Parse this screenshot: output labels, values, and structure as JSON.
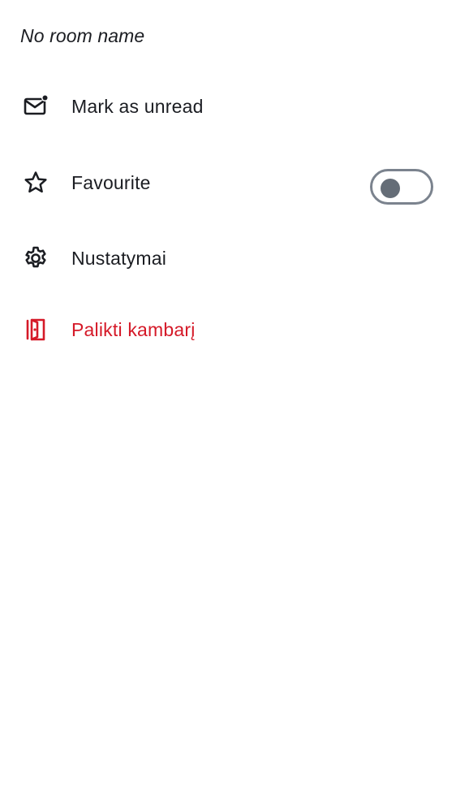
{
  "room": {
    "title": "No room name"
  },
  "menu": {
    "items": [
      {
        "id": "mark-unread",
        "label": "Mark as unread",
        "icon": "mail-unread-icon"
      },
      {
        "id": "favourite",
        "label": "Favourite",
        "icon": "star-icon",
        "toggle": {
          "on": false
        }
      },
      {
        "id": "settings",
        "label": "Nustatymai",
        "icon": "gear-icon"
      },
      {
        "id": "leave",
        "label": "Palikti kambarį",
        "icon": "leave-door-icon",
        "danger": true
      }
    ]
  },
  "colors": {
    "text": "#1b1d22",
    "danger": "#d51928",
    "toggle_border": "#7b838e",
    "toggle_knob": "#656d77",
    "background": "#ffffff"
  }
}
